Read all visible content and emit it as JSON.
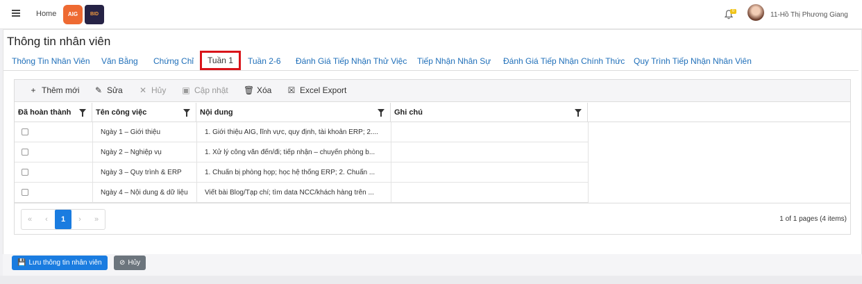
{
  "header": {
    "home": "Home",
    "logo1_text": "AIG",
    "logo2_text": "BID",
    "notification_count": "0",
    "username": "11-Hồ Thị Phương Giang"
  },
  "page": {
    "title": "Thông tin nhân viên"
  },
  "tabs": [
    {
      "label": "Thông Tin Nhân Viên"
    },
    {
      "label": "Văn Bằng"
    },
    {
      "label": "Chứng Chỉ"
    },
    {
      "label": "Tuần 1",
      "active": true
    },
    {
      "label": "Tuần 2-6"
    },
    {
      "label": "Đánh Giá Tiếp Nhận Thử Việc"
    },
    {
      "label": "Tiếp Nhận Nhân Sự"
    },
    {
      "label": "Đánh Giá Tiếp Nhận Chính Thức"
    },
    {
      "label": "Quy Trình Tiếp Nhận Nhân Viên"
    }
  ],
  "toolbar": {
    "add": "Thêm mới",
    "edit": "Sửa",
    "cancel": "Hủy",
    "update": "Cập nhật",
    "delete": "Xóa",
    "export": "Excel Export"
  },
  "columns": [
    "Đã hoàn thành",
    "Tên công việc",
    "Nội dung",
    "Ghi chú"
  ],
  "rows": [
    {
      "done": false,
      "name": "Ngày 1 – Giới thiệu",
      "content": "1. Giới thiệu AIG, lĩnh vực, quy định, tài khoản ERP; 2....",
      "note": ""
    },
    {
      "done": false,
      "name": "Ngày 2 – Nghiệp vụ",
      "content": "1. Xử lý công văn đến/đi; tiếp nhận – chuyển phòng b...",
      "note": ""
    },
    {
      "done": false,
      "name": "Ngày 3 – Quy trình & ERP",
      "content": "1. Chuẩn bị phòng họp; học hệ thống ERP; 2. Chuẩn ...",
      "note": ""
    },
    {
      "done": false,
      "name": "Ngày 4 – Nội dung & dữ liệu",
      "content": "Viết bài Blog/Tạp chí; tìm data NCC/khách hàng trên ...",
      "note": ""
    }
  ],
  "pager": {
    "first": "«",
    "prev": "‹",
    "current": "1",
    "next": "›",
    "last": "»",
    "info": "1 of 1 pages (4 items)"
  },
  "footer": {
    "save": "Lưu thông tin nhân viên",
    "cancel": "Hủy"
  },
  "colors": {
    "accent": "#1a7ce0",
    "tab_link": "#1f6fb9",
    "active_tab_border": "#d9141a"
  }
}
